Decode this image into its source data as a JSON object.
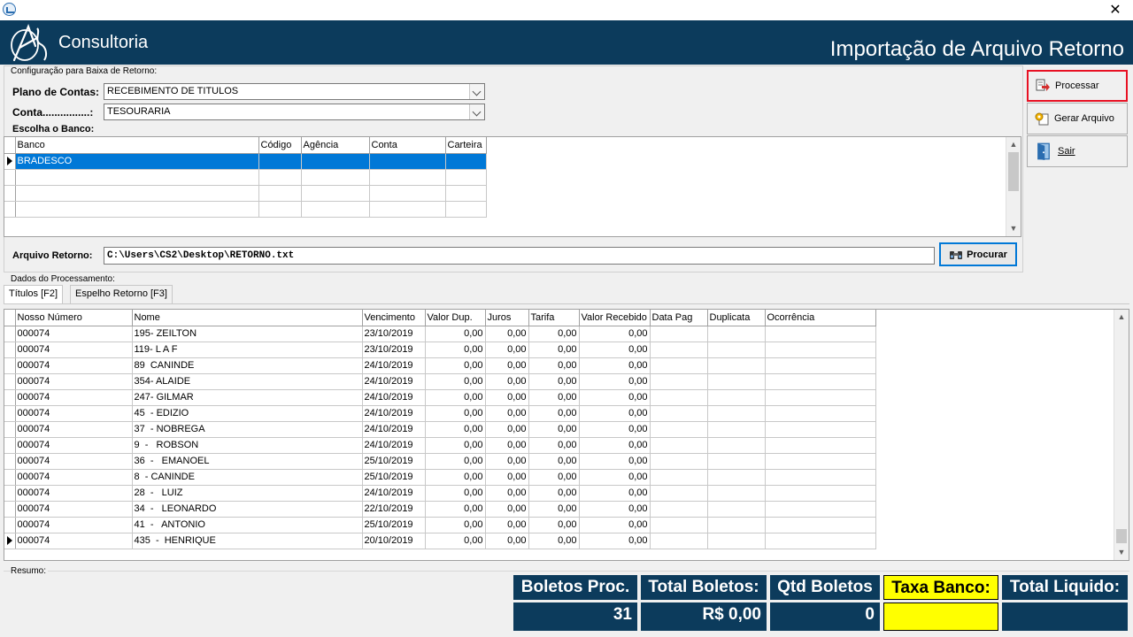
{
  "window": {
    "close_glyph": "✕"
  },
  "header": {
    "brand": "Consultoria",
    "title": "Importação de Arquivo Retorno",
    "bg_color": "#0c3b5c"
  },
  "config": {
    "section_label": "Configuração para Baixa de Retorno:",
    "plano_label": "Plano de Contas:",
    "plano_value": "RECEBIMENTO DE TITULOS",
    "conta_label": "Conta................:",
    "conta_value": "TESOURARIA",
    "banco_label": "Escolha o Banco:",
    "bank_columns": [
      "Banco",
      "Código",
      "Agência",
      "Conta",
      "Carteira"
    ],
    "bank_rows": [
      [
        "BRADESCO",
        "",
        "",
        "",
        ""
      ],
      [
        "",
        "",
        "",
        "",
        ""
      ],
      [
        "",
        "",
        "",
        "",
        ""
      ],
      [
        "",
        "",
        "",
        "",
        ""
      ]
    ],
    "arquivo_label": "Arquivo Retorno:",
    "arquivo_value": "C:\\Users\\CS2\\Desktop\\RETORNO.txt",
    "procurar_label": "Procurar"
  },
  "actions": {
    "processar": "Processar",
    "gerar": "Gerar Arquivo",
    "sair": "Sair",
    "highlight_color": "#e81123"
  },
  "processing": {
    "section_label": "Dados do Processamento:",
    "tabs": [
      "Títulos [F2]",
      "Espelho Retorno [F3]"
    ],
    "columns": [
      "Nosso Número",
      "Nome",
      "Vencimento",
      "Valor Dup.",
      "Juros",
      "Tarifa",
      "Valor Recebido",
      "Data Pag",
      "Duplicata",
      "Ocorrência"
    ],
    "rows": [
      [
        "000074",
        "195- ZEILTON",
        "23/10/2019",
        "0,00",
        "0,00",
        "0,00",
        "0,00",
        "",
        "",
        ""
      ],
      [
        "000074",
        "119- L A F",
        "23/10/2019",
        "0,00",
        "0,00",
        "0,00",
        "0,00",
        "",
        "",
        ""
      ],
      [
        "000074",
        "89  CANINDE",
        "24/10/2019",
        "0,00",
        "0,00",
        "0,00",
        "0,00",
        "",
        "",
        ""
      ],
      [
        "000074",
        "354- ALAIDE",
        "24/10/2019",
        "0,00",
        "0,00",
        "0,00",
        "0,00",
        "",
        "",
        ""
      ],
      [
        "000074",
        "247- GILMAR",
        "24/10/2019",
        "0,00",
        "0,00",
        "0,00",
        "0,00",
        "",
        "",
        ""
      ],
      [
        "000074",
        "45  - EDIZIO",
        "24/10/2019",
        "0,00",
        "0,00",
        "0,00",
        "0,00",
        "",
        "",
        ""
      ],
      [
        "000074",
        "37  - NOBREGA",
        "24/10/2019",
        "0,00",
        "0,00",
        "0,00",
        "0,00",
        "",
        "",
        ""
      ],
      [
        "000074",
        "9  -   ROBSON",
        "24/10/2019",
        "0,00",
        "0,00",
        "0,00",
        "0,00",
        "",
        "",
        ""
      ],
      [
        "000074",
        "36  -   EMANOEL",
        "25/10/2019",
        "0,00",
        "0,00",
        "0,00",
        "0,00",
        "",
        "",
        ""
      ],
      [
        "000074",
        "8  - CANINDE",
        "25/10/2019",
        "0,00",
        "0,00",
        "0,00",
        "0,00",
        "",
        "",
        ""
      ],
      [
        "000074",
        "28  -   LUIZ",
        "24/10/2019",
        "0,00",
        "0,00",
        "0,00",
        "0,00",
        "",
        "",
        ""
      ],
      [
        "000074",
        "34  -   LEONARDO",
        "22/10/2019",
        "0,00",
        "0,00",
        "0,00",
        "0,00",
        "",
        "",
        ""
      ],
      [
        "000074",
        "41  -   ANTONIO",
        "25/10/2019",
        "0,00",
        "0,00",
        "0,00",
        "0,00",
        "",
        "",
        ""
      ],
      [
        "000074",
        "435  -  HENRIQUE",
        "20/10/2019",
        "0,00",
        "0,00",
        "0,00",
        "0,00",
        "",
        "",
        ""
      ]
    ]
  },
  "summary": {
    "label": "Resumo:",
    "boletos_proc_label": "Boletos Proc.",
    "boletos_proc_value": "31",
    "total_boletos_label": "Total Boletos:",
    "total_boletos_value": "R$ 0,00",
    "qtd_boletos_label": "Qtd Boletos",
    "qtd_boletos_value": "0",
    "taxa_banco_label": "Taxa Banco:",
    "taxa_banco_value": "",
    "total_liquido_label": "Total Liquido:",
    "total_liquido_value": ""
  }
}
